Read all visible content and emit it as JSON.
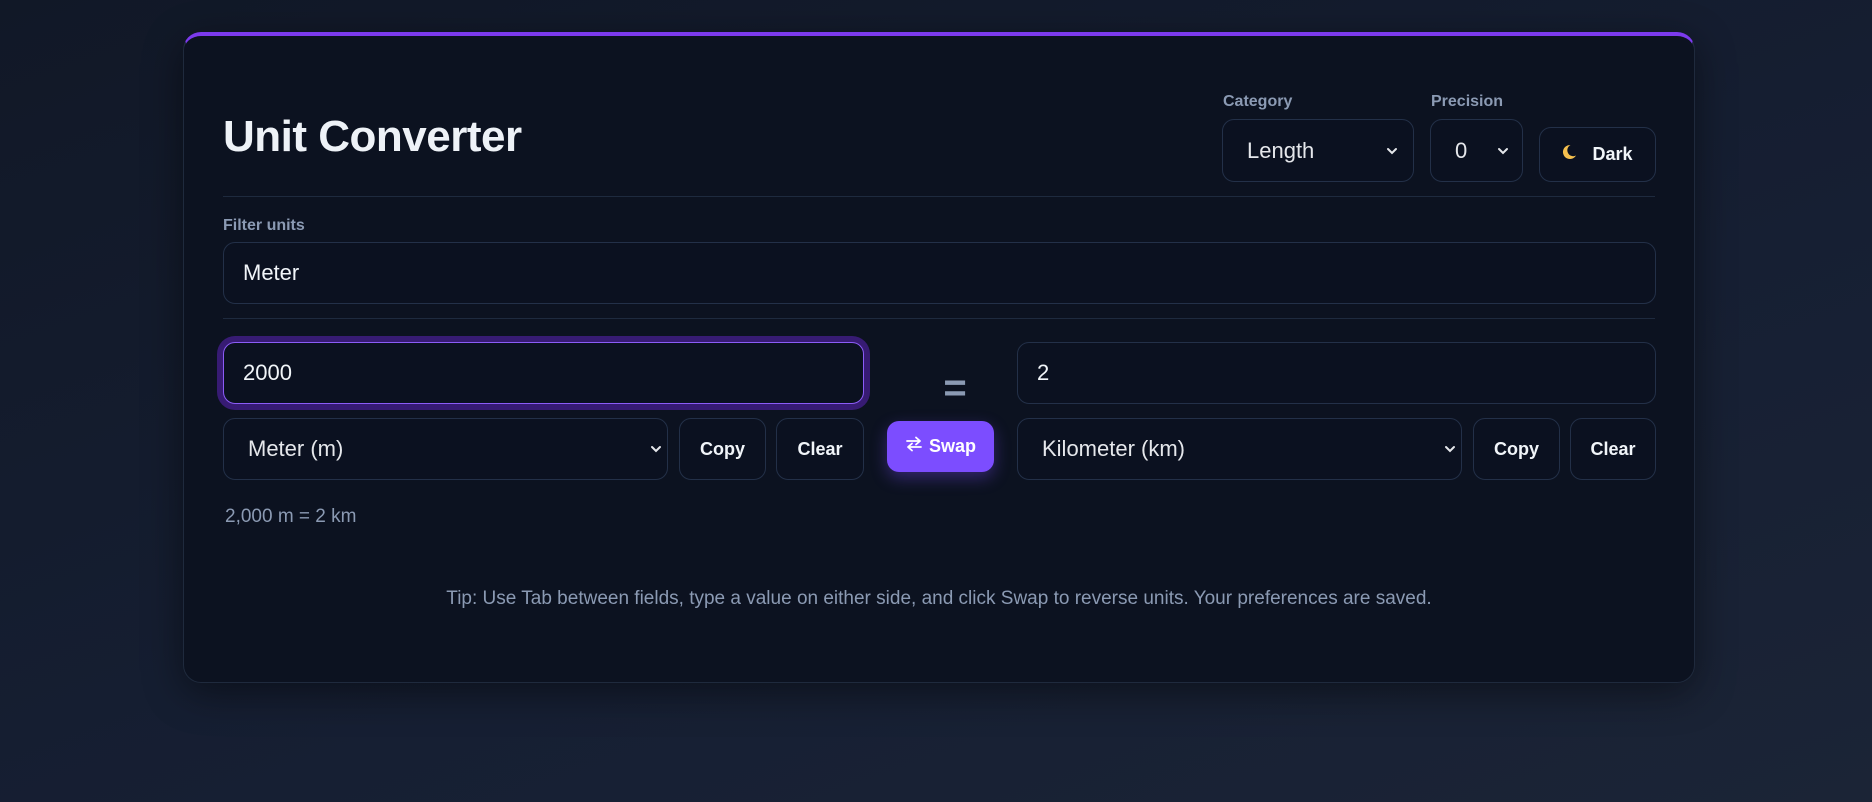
{
  "app": {
    "title": "Unit Converter"
  },
  "controls": {
    "category": {
      "label": "Category",
      "value": "Length"
    },
    "precision": {
      "label": "Precision",
      "value": "0"
    },
    "theme_button": {
      "label": "Dark",
      "icon": "moon-icon"
    }
  },
  "filter": {
    "label": "Filter units",
    "value": "Meter"
  },
  "left": {
    "value": "2000",
    "unit": "Meter (m)",
    "copy_label": "Copy",
    "clear_label": "Clear"
  },
  "right": {
    "value": "2",
    "unit": "Kilometer (km)",
    "copy_label": "Copy",
    "clear_label": "Clear"
  },
  "equals_sign": "=",
  "swap": {
    "label": "Swap",
    "icon": "swap-arrows-icon"
  },
  "summary": "2,000 m = 2 km",
  "tip": "Tip: Use Tab between fields, type a value on either side, and click Swap to reverse units. Your preferences are saved.",
  "colors": {
    "accent": "#7c3aed",
    "swap_button": "#7c4dff",
    "background": "#111827",
    "card": "#0c1220",
    "muted_text": "#8b9ab3"
  }
}
